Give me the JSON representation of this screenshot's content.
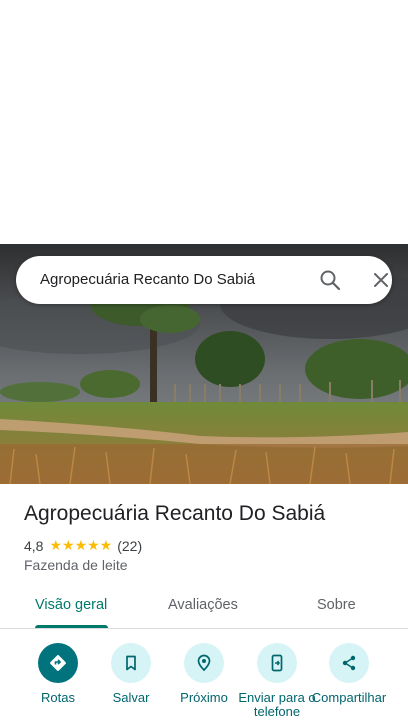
{
  "search": {
    "query": "Agropecuária Recanto Do Sabiá"
  },
  "place": {
    "title": "Agropecuária Recanto Do Sabiá",
    "rating_value": "4,8",
    "stars": "★★★★★",
    "rating_count": "(22)",
    "category": "Fazenda de leite"
  },
  "tabs": [
    {
      "label": "Visão geral",
      "active": true
    },
    {
      "label": "Avaliações",
      "active": false
    },
    {
      "label": "Sobre",
      "active": false
    }
  ],
  "actions": [
    {
      "label": "Rotas",
      "icon": "directions-icon"
    },
    {
      "label": "Salvar",
      "icon": "bookmark-icon"
    },
    {
      "label": "Próximo",
      "icon": "nearby-icon"
    },
    {
      "label": "Enviar para o telefone",
      "icon": "send-to-phone-icon"
    },
    {
      "label": "Compartilhar",
      "icon": "share-icon"
    }
  ],
  "colors": {
    "accent": "#00796b",
    "action_bg": "#d6f3f5",
    "primary_action_bg": "#00737c",
    "star": "#fbbc04"
  }
}
